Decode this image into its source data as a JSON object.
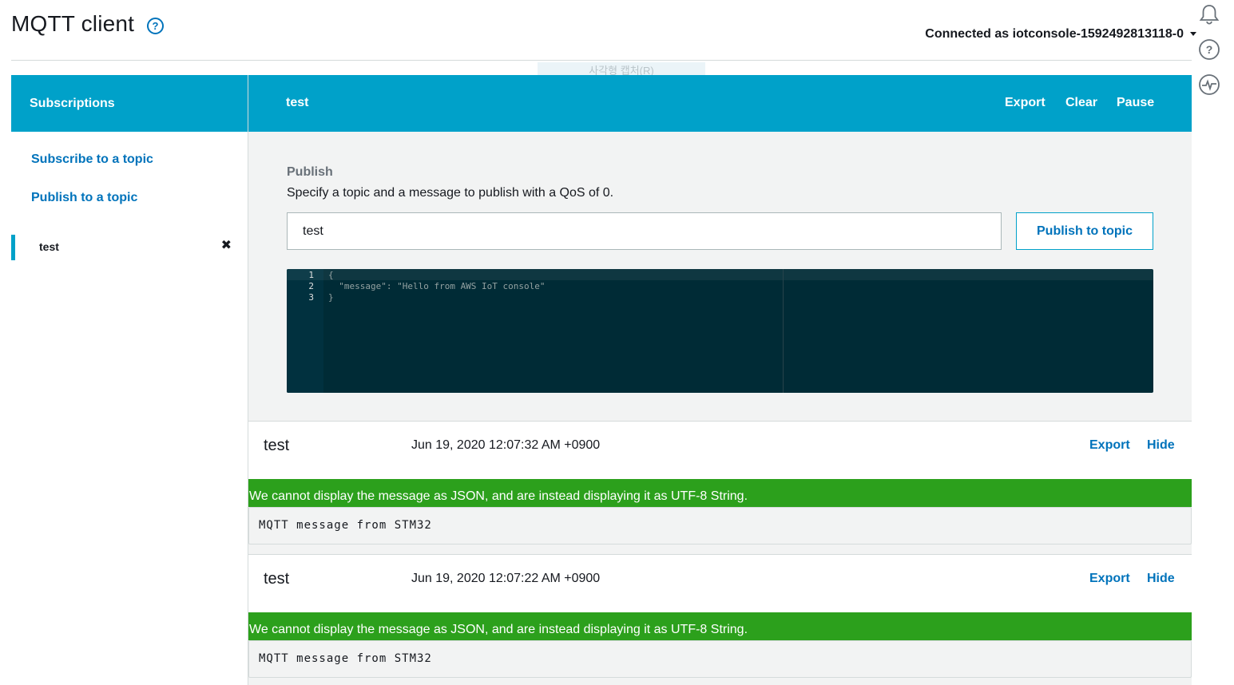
{
  "header": {
    "title": "MQTT client",
    "connected_text": "Connected as iotconsole-1592492813118-0",
    "ghost_tooltip": "사각형 캡처(R)"
  },
  "sidebar": {
    "title": "Subscriptions",
    "subscribe_link": "Subscribe to a topic",
    "publish_link": "Publish to a topic",
    "subscriptions": [
      {
        "label": "test",
        "close": "✖"
      }
    ]
  },
  "main": {
    "topic": "test",
    "actions": {
      "export": "Export",
      "clear": "Clear",
      "pause": "Pause"
    },
    "publish": {
      "title": "Publish",
      "description": "Specify a topic and a message to publish with a QoS of 0.",
      "topic_value": "test",
      "button": "Publish to topic",
      "editor_lines": [
        {
          "n": "1",
          "code": "{"
        },
        {
          "n": "2",
          "code": "  \"message\": \"Hello from AWS IoT console\""
        },
        {
          "n": "3",
          "code": "}"
        }
      ]
    },
    "messages": [
      {
        "topic": "test",
        "time": "Jun 19, 2020 12:07:32 AM +0900",
        "export": "Export",
        "hide": "Hide",
        "warning": "We cannot display the message as JSON, and are instead displaying it as UTF-8 String.",
        "body": "MQTT message from STM32"
      },
      {
        "topic": "test",
        "time": "Jun 19, 2020 12:07:22 AM +0900",
        "export": "Export",
        "hide": "Hide",
        "warning": "We cannot display the message as JSON, and are instead displaying it as UTF-8 String.",
        "body": "MQTT message from STM32"
      }
    ]
  },
  "colors": {
    "accent": "#00a1c9",
    "link": "#0073bb",
    "success": "#2ca01c",
    "editor_bg": "#002b36"
  },
  "icons": [
    "help-icon",
    "caret-down-icon",
    "bell-icon",
    "question-icon",
    "activity-icon",
    "close-icon"
  ]
}
